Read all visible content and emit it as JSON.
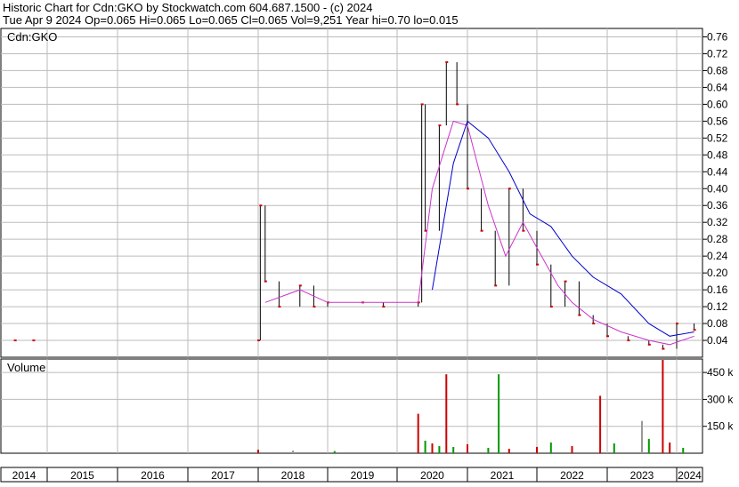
{
  "header": {
    "line1": "Historic Chart for Cdn:GKO by Stockwatch.com 604.687.1500 - (c) 2024",
    "line2": "Tue Apr  9 2024  Op=0.065  Hi=0.065  Lo=0.065  Cl=0.065  Vol=9,251  Year hi=0.70  lo=0.015"
  },
  "colors": {
    "price_bar": "#000000",
    "marker": "#cc0000",
    "ma_short": "#cc33cc",
    "ma_long": "#0000cc",
    "vol_up": "#cc0000",
    "vol_down": "#009900",
    "vol_flat": "#999999",
    "grid": "#bbbbbb"
  },
  "chart_data": [
    {
      "type": "line",
      "title": "Cdn:GKO",
      "y_ticks": [
        "0.76",
        "0.72",
        "0.68",
        "0.64",
        "0.60",
        "0.56",
        "0.52",
        "0.48",
        "0.44",
        "0.40",
        "0.36",
        "0.32",
        "0.28",
        "0.24",
        "0.20",
        "0.16",
        "0.12",
        "0.08",
        "0.04"
      ],
      "ylim": [
        0,
        0.78
      ],
      "grid": true,
      "price_points": [
        {
          "x": 2014.3,
          "y": 0.04
        },
        {
          "x": 2014.7,
          "y": 0.04
        },
        {
          "x": 2018.0,
          "y": 0.04
        },
        {
          "x": 2018.03,
          "y": 0.36
        },
        {
          "x": 2018.1,
          "y": 0.18
        },
        {
          "x": 2018.3,
          "y": 0.12
        },
        {
          "x": 2018.6,
          "y": 0.17
        },
        {
          "x": 2018.8,
          "y": 0.12
        },
        {
          "x": 2019.0,
          "y": 0.13
        },
        {
          "x": 2019.5,
          "y": 0.13
        },
        {
          "x": 2019.8,
          "y": 0.12
        },
        {
          "x": 2020.3,
          "y": 0.13
        },
        {
          "x": 2020.35,
          "y": 0.6
        },
        {
          "x": 2020.4,
          "y": 0.3
        },
        {
          "x": 2020.6,
          "y": 0.55
        },
        {
          "x": 2020.7,
          "y": 0.7
        },
        {
          "x": 2020.85,
          "y": 0.6
        },
        {
          "x": 2021.0,
          "y": 0.4
        },
        {
          "x": 2021.2,
          "y": 0.3
        },
        {
          "x": 2021.4,
          "y": 0.17
        },
        {
          "x": 2021.6,
          "y": 0.4
        },
        {
          "x": 2021.8,
          "y": 0.3
        },
        {
          "x": 2022.0,
          "y": 0.22
        },
        {
          "x": 2022.2,
          "y": 0.12
        },
        {
          "x": 2022.4,
          "y": 0.18
        },
        {
          "x": 2022.6,
          "y": 0.1
        },
        {
          "x": 2022.8,
          "y": 0.08
        },
        {
          "x": 2023.0,
          "y": 0.05
        },
        {
          "x": 2023.3,
          "y": 0.04
        },
        {
          "x": 2023.6,
          "y": 0.03
        },
        {
          "x": 2023.8,
          "y": 0.02
        },
        {
          "x": 2024.0,
          "y": 0.08
        },
        {
          "x": 2024.27,
          "y": 0.065
        }
      ],
      "ma_short": [
        {
          "x": 2018.1,
          "y": 0.13
        },
        {
          "x": 2018.6,
          "y": 0.16
        },
        {
          "x": 2019.0,
          "y": 0.13
        },
        {
          "x": 2020.3,
          "y": 0.13
        },
        {
          "x": 2020.5,
          "y": 0.4
        },
        {
          "x": 2020.8,
          "y": 0.56
        },
        {
          "x": 2021.0,
          "y": 0.55
        },
        {
          "x": 2021.3,
          "y": 0.36
        },
        {
          "x": 2021.55,
          "y": 0.24
        },
        {
          "x": 2021.8,
          "y": 0.32
        },
        {
          "x": 2022.0,
          "y": 0.26
        },
        {
          "x": 2022.3,
          "y": 0.17
        },
        {
          "x": 2022.5,
          "y": 0.13
        },
        {
          "x": 2022.8,
          "y": 0.09
        },
        {
          "x": 2023.2,
          "y": 0.06
        },
        {
          "x": 2023.6,
          "y": 0.04
        },
        {
          "x": 2023.9,
          "y": 0.03
        },
        {
          "x": 2024.27,
          "y": 0.05
        }
      ],
      "ma_long": [
        {
          "x": 2020.5,
          "y": 0.16
        },
        {
          "x": 2020.8,
          "y": 0.46
        },
        {
          "x": 2021.0,
          "y": 0.56
        },
        {
          "x": 2021.3,
          "y": 0.52
        },
        {
          "x": 2021.6,
          "y": 0.44
        },
        {
          "x": 2021.9,
          "y": 0.34
        },
        {
          "x": 2022.2,
          "y": 0.31
        },
        {
          "x": 2022.5,
          "y": 0.24
        },
        {
          "x": 2022.8,
          "y": 0.19
        },
        {
          "x": 2023.2,
          "y": 0.15
        },
        {
          "x": 2023.6,
          "y": 0.08
        },
        {
          "x": 2023.9,
          "y": 0.05
        },
        {
          "x": 2024.27,
          "y": 0.06
        }
      ]
    },
    {
      "type": "bar",
      "title": "Volume",
      "y_ticks": [
        "450 k",
        "300 k",
        "150 k"
      ],
      "ylim": [
        0,
        525
      ],
      "x_ticks": [
        "2014",
        "2015",
        "2016",
        "2017",
        "2018",
        "2019",
        "2020",
        "2021",
        "2022",
        "2023",
        "2024"
      ],
      "bars": [
        {
          "x": 2018.0,
          "v": 20,
          "dir": "up"
        },
        {
          "x": 2018.5,
          "v": 15,
          "dir": "flat"
        },
        {
          "x": 2019.1,
          "v": 12,
          "dir": "down"
        },
        {
          "x": 2020.3,
          "v": 220,
          "dir": "up"
        },
        {
          "x": 2020.4,
          "v": 70,
          "dir": "down"
        },
        {
          "x": 2020.5,
          "v": 55,
          "dir": "up"
        },
        {
          "x": 2020.6,
          "v": 40,
          "dir": "down"
        },
        {
          "x": 2020.7,
          "v": 440,
          "dir": "up"
        },
        {
          "x": 2020.8,
          "v": 35,
          "dir": "down"
        },
        {
          "x": 2021.0,
          "v": 50,
          "dir": "up"
        },
        {
          "x": 2021.3,
          "v": 30,
          "dir": "down"
        },
        {
          "x": 2021.45,
          "v": 440,
          "dir": "down"
        },
        {
          "x": 2021.6,
          "v": 25,
          "dir": "up"
        },
        {
          "x": 2022.0,
          "v": 35,
          "dir": "up"
        },
        {
          "x": 2022.2,
          "v": 60,
          "dir": "down"
        },
        {
          "x": 2022.5,
          "v": 40,
          "dir": "up"
        },
        {
          "x": 2022.9,
          "v": 320,
          "dir": "up"
        },
        {
          "x": 2023.1,
          "v": 55,
          "dir": "down"
        },
        {
          "x": 2023.5,
          "v": 180,
          "dir": "flat"
        },
        {
          "x": 2023.6,
          "v": 80,
          "dir": "down"
        },
        {
          "x": 2023.8,
          "v": 520,
          "dir": "up"
        },
        {
          "x": 2023.9,
          "v": 60,
          "dir": "up"
        },
        {
          "x": 2024.1,
          "v": 30,
          "dir": "down"
        }
      ]
    }
  ]
}
